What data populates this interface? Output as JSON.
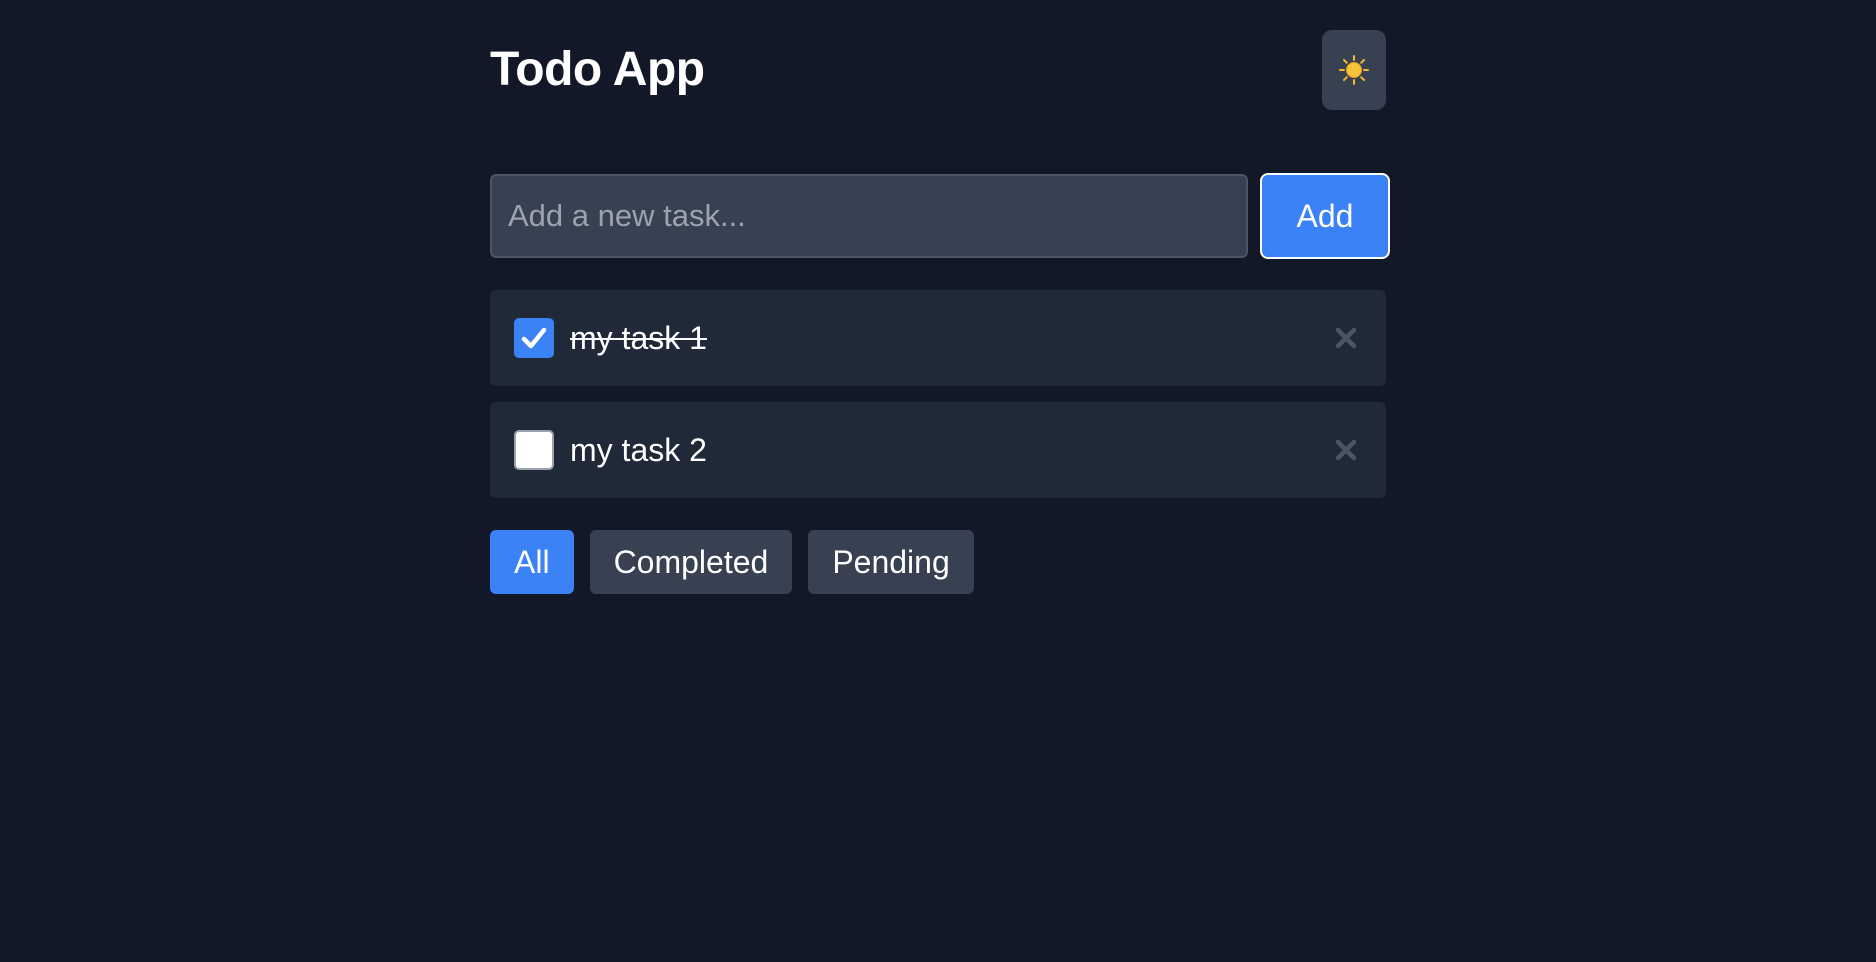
{
  "header": {
    "title": "Todo App",
    "theme_toggle_icon": "sun-icon"
  },
  "new_task": {
    "value": "",
    "placeholder": "Add a new task...",
    "add_label": "Add"
  },
  "tasks": [
    {
      "text": "my task 1",
      "completed": true
    },
    {
      "text": "my task 2",
      "completed": false
    }
  ],
  "filters": [
    {
      "label": "All",
      "active": true
    },
    {
      "label": "Completed",
      "active": false
    },
    {
      "label": "Pending",
      "active": false
    }
  ],
  "colors": {
    "background": "#121828",
    "panel": "#1f2937",
    "control": "#374151",
    "accent": "#3b82f6",
    "sun": "#f5b82e"
  }
}
